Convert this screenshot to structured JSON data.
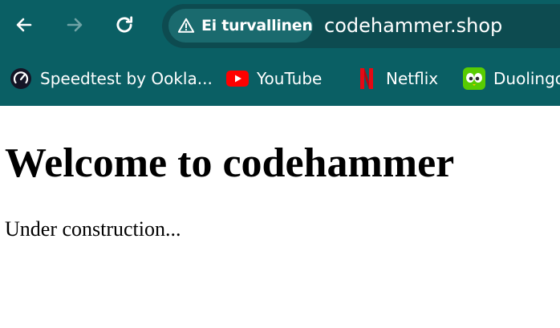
{
  "browser": {
    "nav": {
      "back_icon": "arrow-left-icon",
      "forward_icon": "arrow-right-icon",
      "reload_icon": "reload-icon"
    },
    "omnibox": {
      "security_icon": "warning-triangle-icon",
      "security_label": "Ei turvallinen",
      "url": "codehammer.shop"
    },
    "bookmarks": [
      {
        "label": "Speedtest by Ookla...",
        "icon": "speedtest-icon"
      },
      {
        "label": "YouTube",
        "icon": "youtube-icon"
      },
      {
        "label": "Netflix",
        "icon": "netflix-icon"
      },
      {
        "label": "Duolingo",
        "icon": "duolingo-icon"
      }
    ],
    "colors": {
      "toolbar": "#0a5f64",
      "omnibox": "#0d4b50",
      "security_chip": "#1a6a6e"
    }
  },
  "page": {
    "heading": "Welcome to codehammer",
    "text": "Under construction..."
  }
}
